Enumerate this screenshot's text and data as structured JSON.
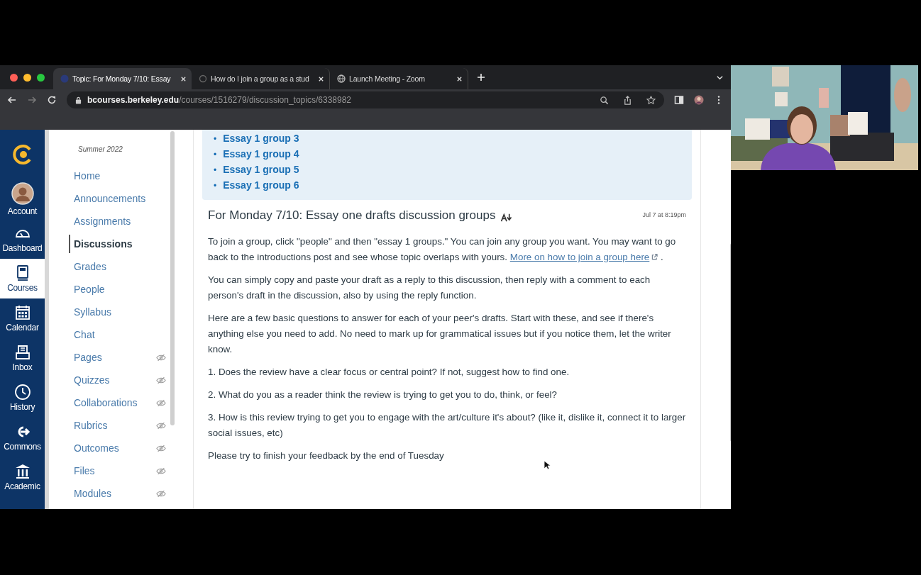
{
  "browser": {
    "tabs": [
      {
        "title": "Topic: For Monday 7/10: Essay",
        "selected": true
      },
      {
        "title": "How do I join a group as a stud",
        "selected": false
      },
      {
        "title": "Launch Meeting - Zoom",
        "selected": false
      }
    ],
    "address": {
      "host": "bcourses.berkeley.edu",
      "path": "/courses/1516279/discussion_topics/6338982"
    }
  },
  "global_nav": [
    {
      "label": "Account",
      "kind": "avatar",
      "selected": false
    },
    {
      "label": "Dashboard",
      "kind": "dashboard",
      "selected": false
    },
    {
      "label": "Courses",
      "kind": "courses",
      "selected": true
    },
    {
      "label": "Calendar",
      "kind": "calendar",
      "selected": false
    },
    {
      "label": "Inbox",
      "kind": "inbox",
      "selected": false
    },
    {
      "label": "History",
      "kind": "history",
      "selected": false
    },
    {
      "label": "Commons",
      "kind": "commons",
      "selected": false
    },
    {
      "label": "Academic",
      "kind": "academic",
      "selected": false
    }
  ],
  "course_nav": {
    "term": "Summer 2022",
    "items": [
      {
        "label": "Home",
        "selected": false,
        "hidden": false
      },
      {
        "label": "Announcements",
        "selected": false,
        "hidden": false
      },
      {
        "label": "Assignments",
        "selected": false,
        "hidden": false
      },
      {
        "label": "Discussions",
        "selected": true,
        "hidden": false
      },
      {
        "label": "Grades",
        "selected": false,
        "hidden": false
      },
      {
        "label": "People",
        "selected": false,
        "hidden": false
      },
      {
        "label": "Syllabus",
        "selected": false,
        "hidden": false
      },
      {
        "label": "Chat",
        "selected": false,
        "hidden": false
      },
      {
        "label": "Pages",
        "selected": false,
        "hidden": true
      },
      {
        "label": "Quizzes",
        "selected": false,
        "hidden": true
      },
      {
        "label": "Collaborations",
        "selected": false,
        "hidden": true
      },
      {
        "label": "Rubrics",
        "selected": false,
        "hidden": true
      },
      {
        "label": "Outcomes",
        "selected": false,
        "hidden": true
      },
      {
        "label": "Files",
        "selected": false,
        "hidden": true
      },
      {
        "label": "Modules",
        "selected": false,
        "hidden": true
      }
    ]
  },
  "group_links": {
    "marker": "•",
    "items": [
      "Essay 1 group 3",
      "Essay 1 group 4",
      "Essay 1 group 5",
      "Essay 1 group 6"
    ]
  },
  "post": {
    "title": "For Monday 7/10: Essay one drafts discussion groups",
    "date": "Jul 7 at 8:19pm",
    "paragraphs": [
      {
        "text": "To join a group, click \"people\" and then \"essay 1 groups.\" You can join any group you want. You may want to go back to the introductions post and see whose topic overlaps with yours.",
        "link": "More on how to join a group here",
        "after": "."
      },
      {
        "text": "You can simply copy and paste your draft as a reply to this discussion, then reply with a comment to each person's draft in the discussion, also by using the reply function."
      },
      {
        "text": "Here are a few basic questions to answer for each of your peer's drafts. Start with these, and see if there's anything else you need to add. No need to mark up for grammatical issues but if you notice them, let the writer know."
      },
      {
        "text": "1. Does the review have a clear focus or central point? If not, suggest how to find one."
      },
      {
        "text": "2. What do you as a reader think the review is trying to get you to do, think, or feel?"
      },
      {
        "text": "3. How is this review trying to get you to engage with the art/culture it's about? (like it, dislike it, connect it to larger social issues, etc)"
      },
      {
        "text": "Please try to finish your feedback by the end of Tuesday"
      }
    ]
  }
}
